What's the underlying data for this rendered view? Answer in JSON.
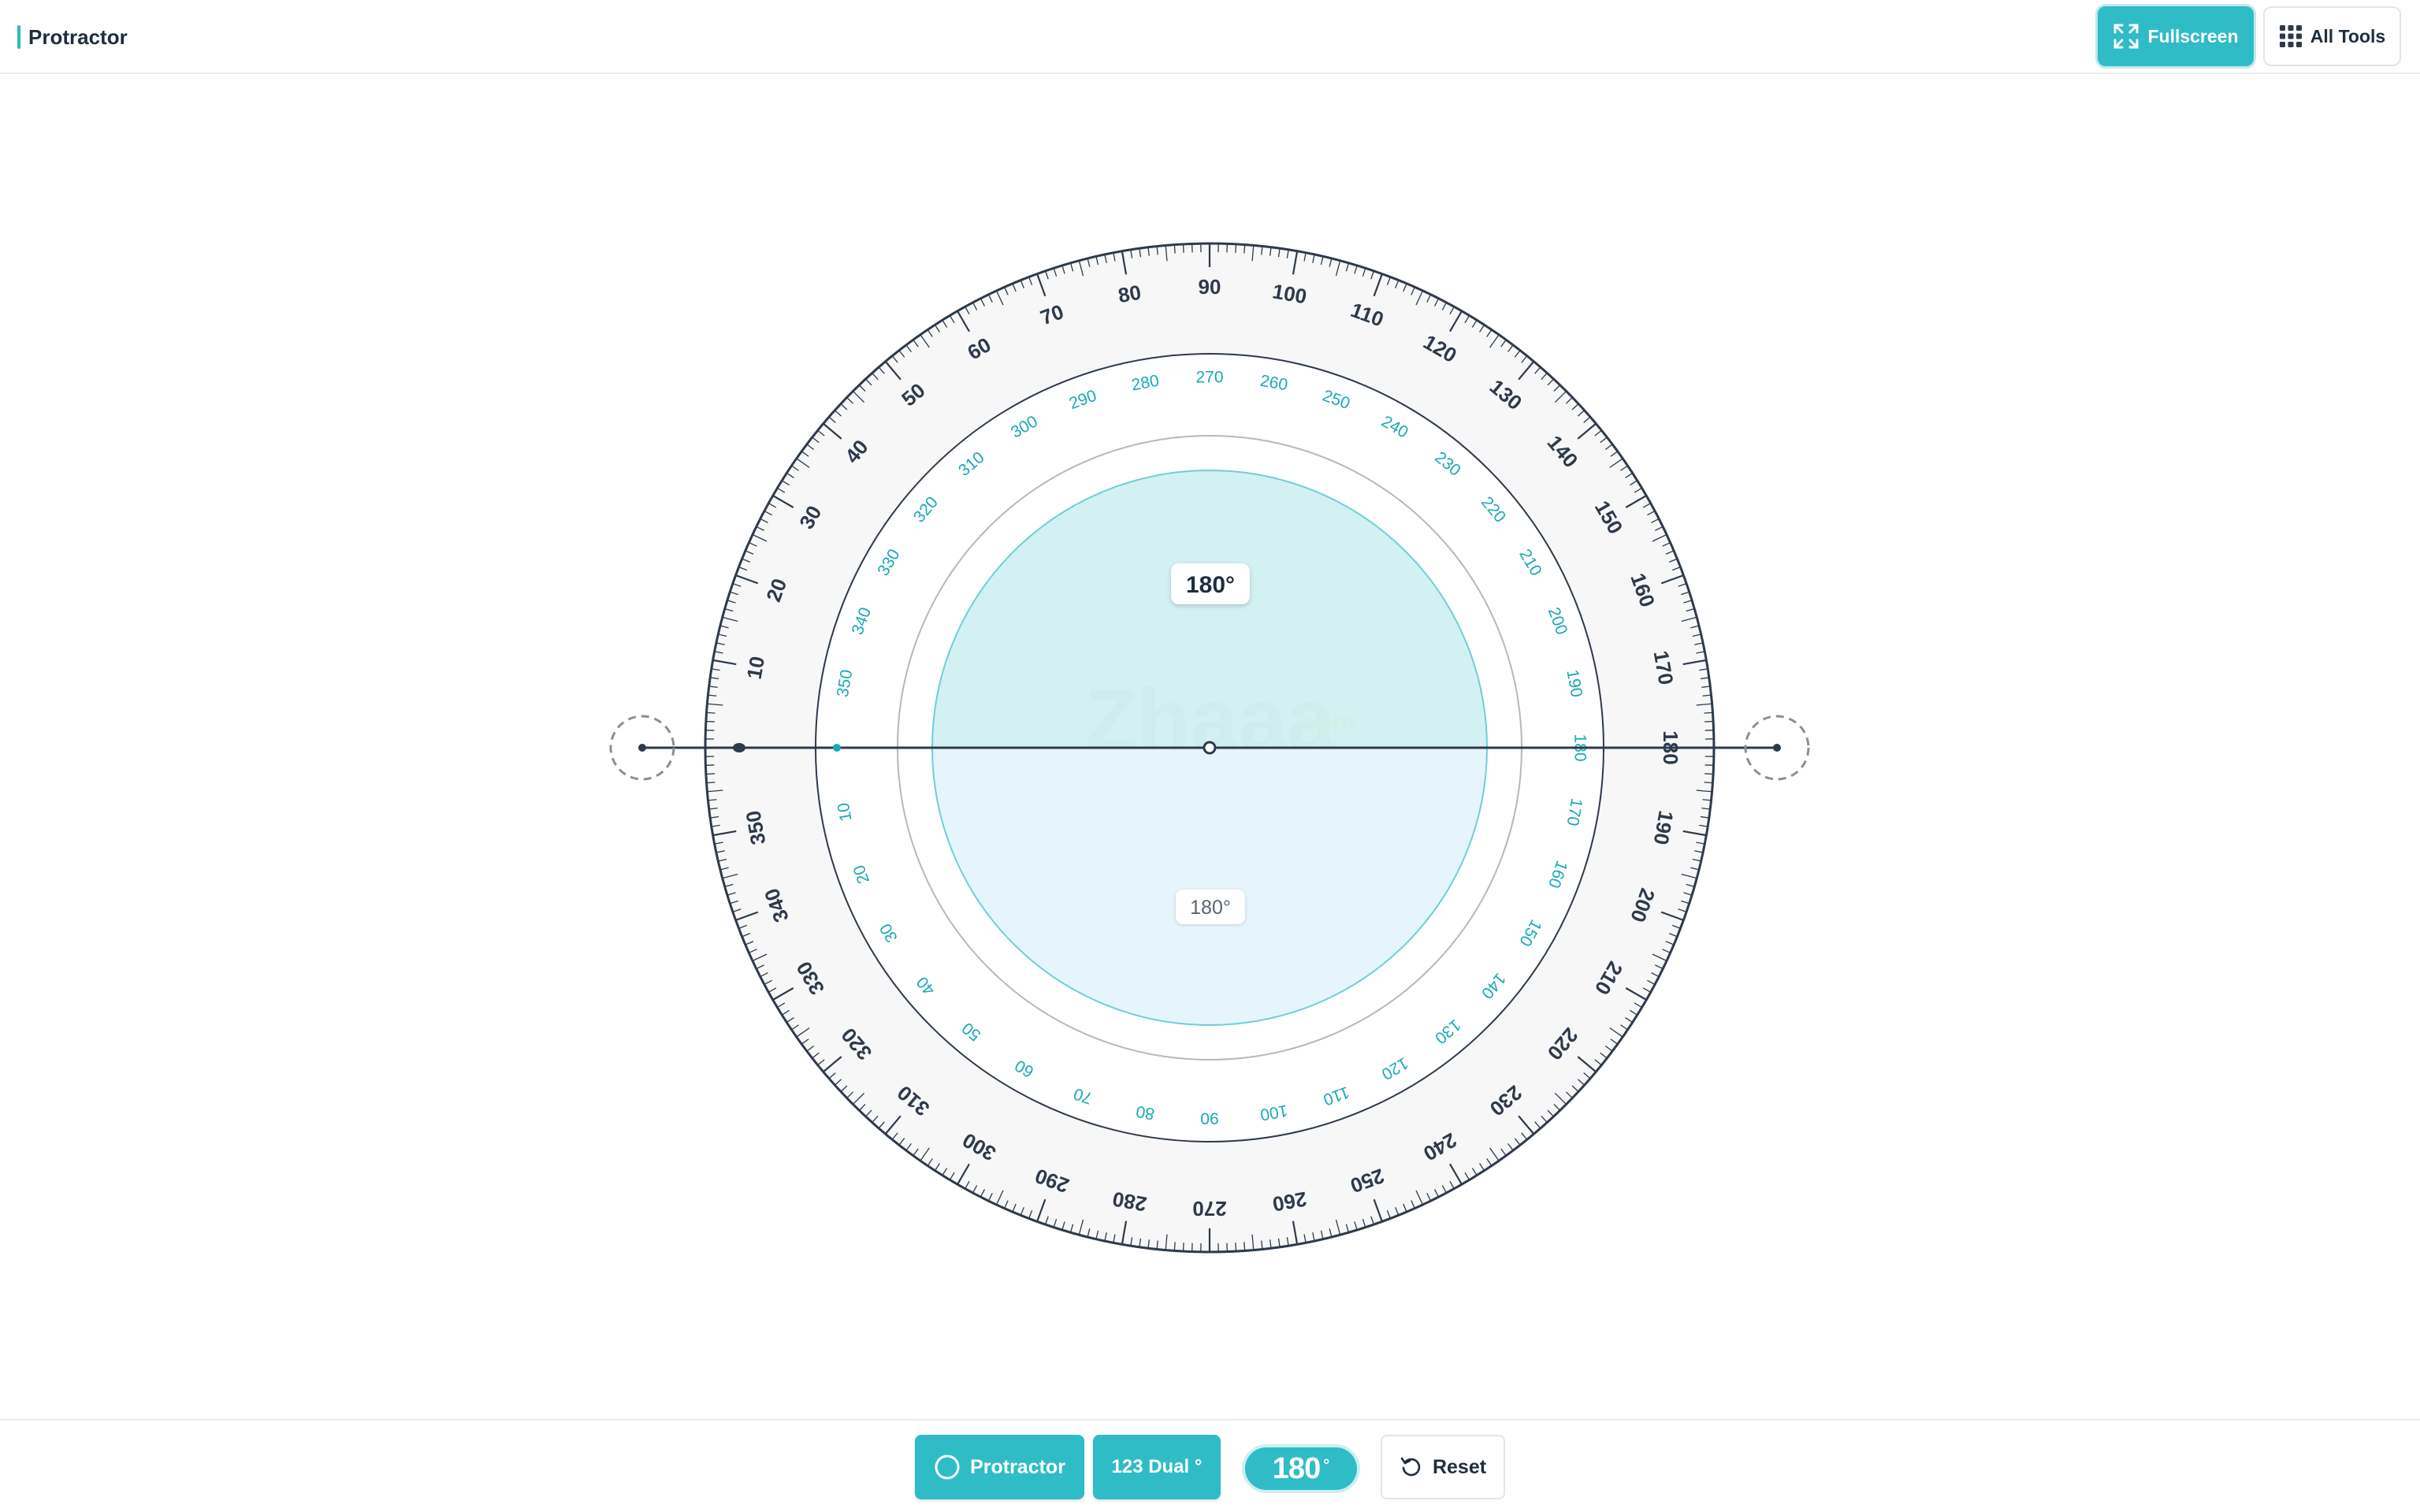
{
  "app": {
    "title": "Protractor"
  },
  "header": {
    "fullscreen_label": "Fullscreen",
    "fullscreen_icon": "expand-icon",
    "all_tools_label": "All Tools",
    "all_tools_icon": "grid-icon"
  },
  "protractor": {
    "top_angle_label": "180°",
    "bottom_angle_label": "180°",
    "watermark": "Zhaaa",
    "watermark_suffix": "com",
    "outer_scale_step": 10,
    "inner_scale_step": 10,
    "colors": {
      "outer_text": "#2d3a4b",
      "inner_text": "#1aa9b6",
      "fill_top": "#d3f0f2",
      "fill_bottom": "#e6f4fb",
      "ring_bg": "#f7f7f7"
    }
  },
  "toolbar": {
    "protractor_label": "Protractor",
    "protractor_icon": "circle-icon",
    "dual_label": "123 Dual °",
    "angle_value": "180",
    "angle_unit": "°",
    "reset_label": "Reset",
    "reset_icon": "reset-icon"
  }
}
